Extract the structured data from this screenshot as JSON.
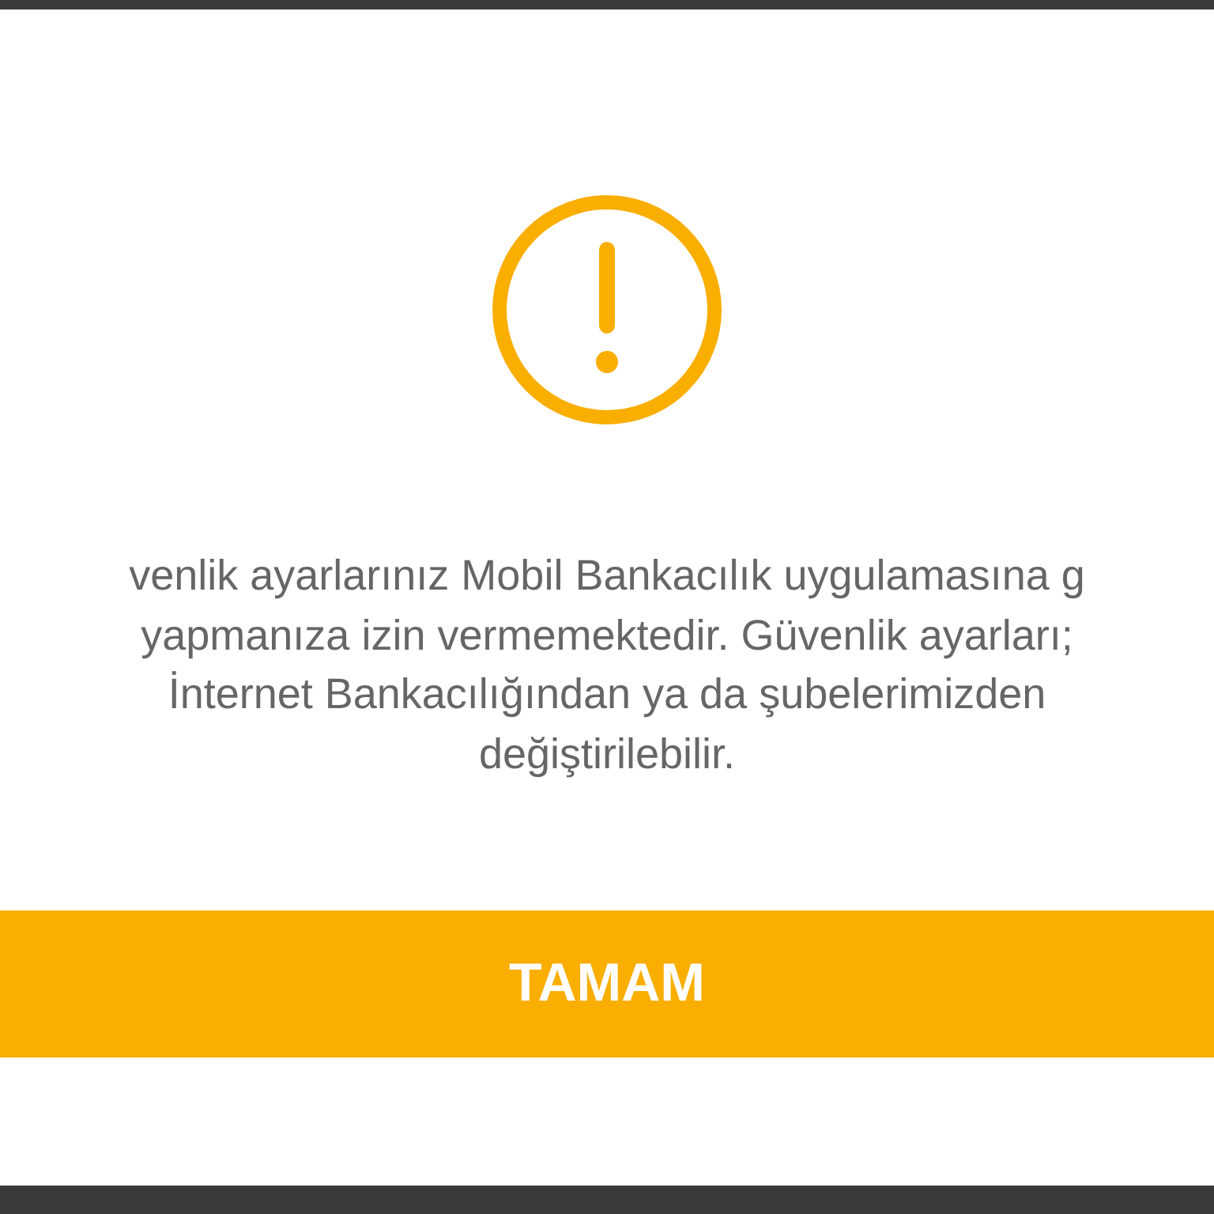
{
  "dialog": {
    "message_lines": [
      "venlik ayarlarınız Mobil Bankacılık uygulamasına g",
      "yapmanıza izin vermemektedir. Güvenlik ayarları;",
      "İnternet Bankacılığından ya da şubelerimizden",
      "değiştirilebilir."
    ],
    "button": "TAMAM"
  }
}
